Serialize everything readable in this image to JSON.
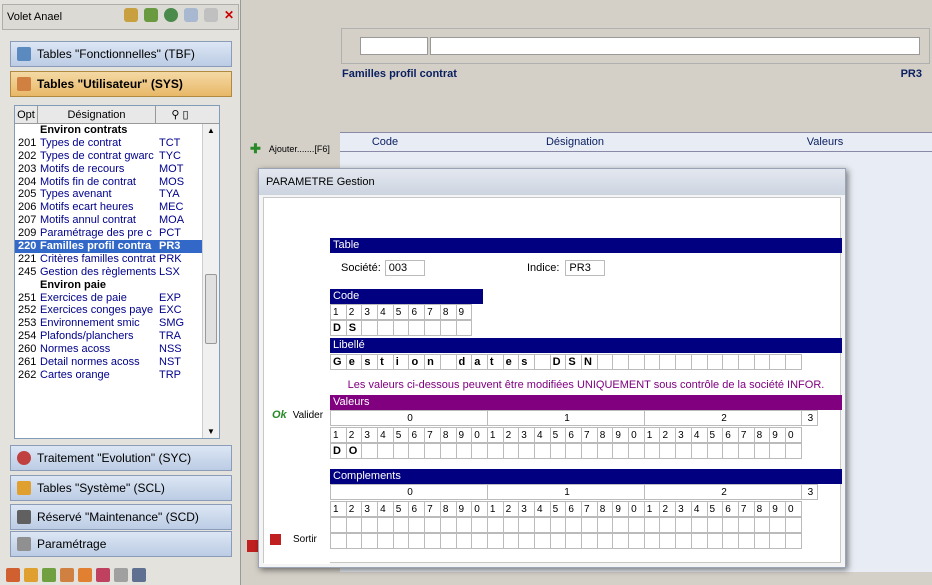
{
  "volet": {
    "title": "Volet Anael"
  },
  "sections": [
    {
      "label": "Tables \"Fonctionnelles\" (TBF)"
    },
    {
      "label": "Tables \"Utilisateur\" (SYS)"
    },
    {
      "label": "Traitement \"Evolution\" (SYC)"
    },
    {
      "label": "Tables \"Système\" (SCL)"
    },
    {
      "label": "Réservé \"Maintenance\" (SCD)"
    },
    {
      "label": "Paramétrage"
    }
  ],
  "table": {
    "headers": [
      "Opt",
      "Désignation",
      ""
    ],
    "rows": [
      {
        "opt": "",
        "des": "Environ contrats",
        "code": "",
        "grp": true
      },
      {
        "opt": "201",
        "des": "Types de contrat",
        "code": "TCT"
      },
      {
        "opt": "202",
        "des": "Types de contrat gwarc",
        "code": "TYC"
      },
      {
        "opt": "203",
        "des": "Motifs de recours",
        "code": "MOT"
      },
      {
        "opt": "204",
        "des": "Motifs fin de contrat",
        "code": "MOS"
      },
      {
        "opt": "205",
        "des": "Types avenant",
        "code": "TYA"
      },
      {
        "opt": "206",
        "des": "Motifs ecart heures",
        "code": "MEC"
      },
      {
        "opt": "207",
        "des": "Motifs annul contrat",
        "code": "MOA"
      },
      {
        "opt": "209",
        "des": "Paramétrage des pre c",
        "code": "PCT"
      },
      {
        "opt": "220",
        "des": "Familles profil contra",
        "code": "PR3",
        "sel": true
      },
      {
        "opt": "221",
        "des": "Critères familles contrat",
        "code": "PRK"
      },
      {
        "opt": "245",
        "des": "Gestion des règlements",
        "code": "LSX"
      },
      {
        "opt": "",
        "des": "Environ paie",
        "code": "",
        "grp": true
      },
      {
        "opt": "251",
        "des": "Exercices de paie",
        "code": "EXP"
      },
      {
        "opt": "252",
        "des": "Exercices conges paye",
        "code": "EXC"
      },
      {
        "opt": "253",
        "des": "Environnement smic",
        "code": "SMG"
      },
      {
        "opt": "254",
        "des": "Plafonds/planchers",
        "code": "TRA"
      },
      {
        "opt": "260",
        "des": "Normes acoss",
        "code": "NSS"
      },
      {
        "opt": "261",
        "des": "Detail normes acoss",
        "code": "NST"
      },
      {
        "opt": "262",
        "des": "Cartes orange",
        "code": "TRP"
      }
    ]
  },
  "main": {
    "list_title": "Familles profil contrat",
    "list_code": "PR3",
    "ajouter": "Ajouter.......[F6]",
    "cols": [
      "Code",
      "Désignation",
      "Valeurs"
    ]
  },
  "dialog": {
    "title": "PARAMETRE Gestion",
    "valider": "Valider",
    "ok": "Ok",
    "sortir": "Sortir",
    "table_lbl": "Table",
    "societe_lbl": "Société:",
    "societe": "003",
    "indice_lbl": "Indice:",
    "indice": "PR3",
    "code_lbl": "Code",
    "code_digits": [
      "1",
      "2",
      "3",
      "4",
      "5",
      "6",
      "7",
      "8",
      "9"
    ],
    "code_val": [
      "D",
      "S",
      "",
      "",
      "",
      "",
      "",
      "",
      ""
    ],
    "libelle_lbl": "Libellé",
    "libelle_val": [
      "G",
      "e",
      "s",
      "t",
      "i",
      "o",
      "n",
      "",
      "d",
      "a",
      "t",
      "e",
      "s",
      "",
      "D",
      "S",
      "N",
      "",
      "",
      "",
      "",
      "",
      "",
      "",
      "",
      "",
      "",
      "",
      "",
      ""
    ],
    "info": "Les valeurs ci-dessous peuvent être modifiées UNIQUEMENT sous contrôle de la société INFOR.",
    "valeurs_lbl": "Valeurs",
    "complements_lbl": "Complements",
    "tens": [
      "0",
      "",
      "",
      "",
      "",
      "",
      "",
      "",
      "",
      "",
      "1",
      "",
      "",
      "",
      "",
      "",
      "",
      "",
      "",
      "",
      "2",
      "",
      "",
      "",
      "",
      "",
      "",
      "",
      "",
      "",
      "3"
    ],
    "digits": [
      "1",
      "2",
      "3",
      "4",
      "5",
      "6",
      "7",
      "8",
      "9",
      "0",
      "1",
      "2",
      "3",
      "4",
      "5",
      "6",
      "7",
      "8",
      "9",
      "0",
      "1",
      "2",
      "3",
      "4",
      "5",
      "6",
      "7",
      "8",
      "9",
      "0"
    ],
    "valeurs_val": [
      "D",
      "O",
      "",
      "",
      "",
      "",
      "",
      "",
      "",
      "",
      "",
      "",
      "",
      "",
      "",
      "",
      "",
      "",
      "",
      "",
      "",
      "",
      "",
      "",
      "",
      "",
      "",
      "",
      "",
      ""
    ]
  },
  "colors": {
    "navy": "#000080",
    "purple": "#800080",
    "selection": "#3268c8"
  }
}
